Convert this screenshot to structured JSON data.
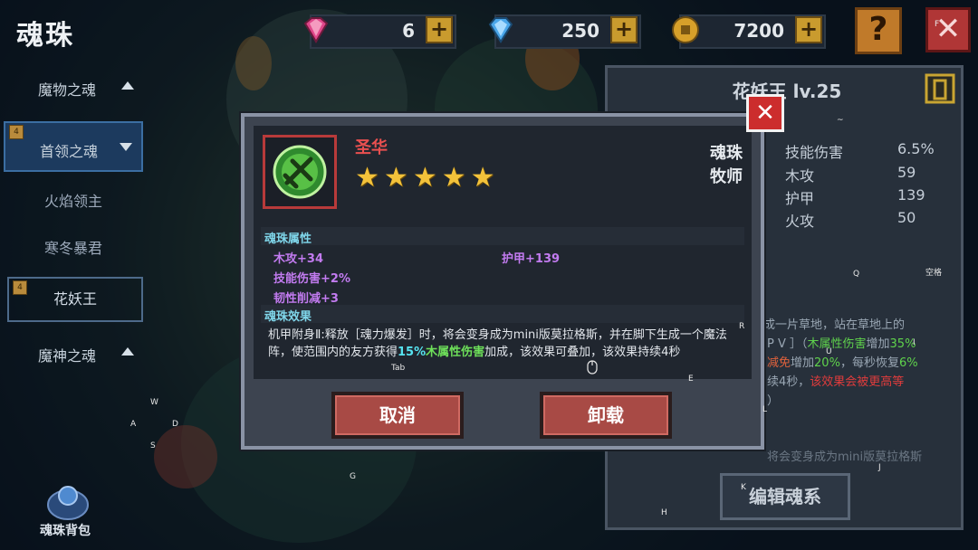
{
  "header": {
    "title": "魂珠",
    "currencies": [
      {
        "icon": "pink-gem-icon",
        "value": "6",
        "color": "#e0468a"
      },
      {
        "icon": "blue-gem-icon",
        "value": "250",
        "color": "#4aa6ea"
      },
      {
        "icon": "gold-coin-icon",
        "value": "7200",
        "color": "#d7a02a"
      }
    ],
    "plus_label": "+",
    "help_label": "?",
    "close_label": "✕"
  },
  "sidebar": {
    "items": [
      {
        "label": "魔物之魂",
        "arrow": "up"
      },
      {
        "label": "首领之魂",
        "arrow": "down",
        "badge": "4"
      },
      {
        "label": "火焰领主"
      },
      {
        "label": "寒冬暴君"
      },
      {
        "label": "花妖王",
        "badge": "4"
      },
      {
        "label": "魔神之魂",
        "arrow": "up"
      }
    ],
    "bag_label": "魂珠背包"
  },
  "info_panel": {
    "title": "花妖王 lv.25",
    "stats": [
      {
        "name": "技能伤害",
        "value": "6.5%"
      },
      {
        "name": "木攻",
        "value": "59"
      },
      {
        "name": "护甲",
        "value": "139"
      },
      {
        "name": "火攻",
        "value": "50"
      }
    ],
    "desc_line1": "成一片草地，站在草地上的",
    "desc_line2_a": "P V ］（",
    "desc_line2_b": "木属性伤害",
    "desc_line2_c": "增加",
    "desc_line2_d": "35%",
    "desc_line3_a": "减免",
    "desc_line3_b": "增加",
    "desc_line3_c": "20%",
    "desc_line3_d": "，每秒恢复",
    "desc_line3_e": "6%",
    "desc_line4_a": "续4秒，",
    "desc_line4_b": "该效果会被更高等",
    "desc_line5": "）",
    "desc_line6": "将会变身成为mini版莫拉格斯",
    "edit_label": "编辑魂系"
  },
  "modal": {
    "gem_name": "圣华",
    "stars": 5,
    "star_glyph": "★",
    "type": "魂珠",
    "class": "牧师",
    "attr_title": "魂珠属性",
    "attrs": [
      "木攻+34",
      "护甲+139",
      "技能伤害+2%",
      "韧性削减+3"
    ],
    "effect_title": "魂珠效果",
    "effect_a": "机甲附身Ⅱ:释放［魂力爆发］时，将会变身成为mini版莫拉格斯，并在脚下生成一个魔法阵，使范围内的友方获得",
    "effect_hl1": "15%",
    "effect_hl2": "木属性伤害",
    "effect_b": "加成，该效果可叠加，该效果持续4秒",
    "cancel_label": "取消",
    "unload_label": "卸载",
    "close_label": "✕"
  },
  "key_hints": [
    "F",
    "~",
    "Q",
    "空格",
    "R",
    "I",
    "U",
    "E",
    "Tab",
    "W",
    "A",
    "D",
    "S",
    "L",
    "J",
    "G",
    "K",
    "H"
  ]
}
